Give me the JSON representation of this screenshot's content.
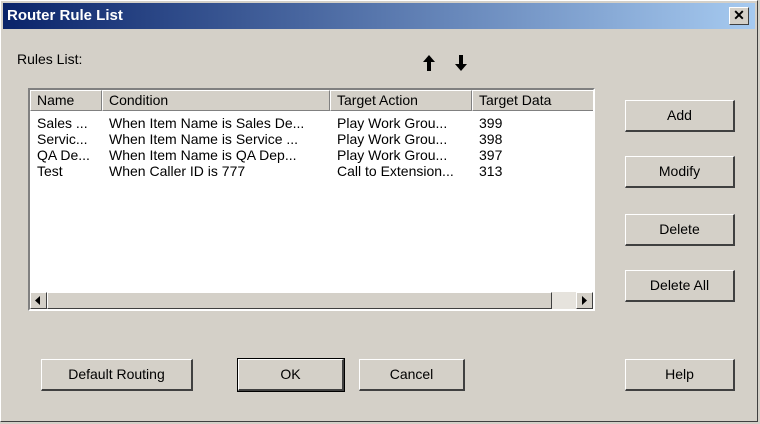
{
  "window": {
    "title": "Router Rule List",
    "close_label": "✕"
  },
  "rules_label": "Rules List:",
  "list": {
    "columns": [
      "Name",
      "Condition",
      "Target Action",
      "Target Data"
    ],
    "rows": [
      [
        "Sales ...",
        "When Item Name is Sales De...",
        "Play Work Grou...",
        "399"
      ],
      [
        "Servic...",
        "When Item Name is Service ...",
        "Play Work Grou...",
        "398"
      ],
      [
        "QA De...",
        "When Item Name is QA Dep...",
        "Play Work Grou...",
        "397"
      ],
      [
        "Test",
        "When Caller ID is 777",
        "Call to Extension...",
        "313"
      ]
    ]
  },
  "side_buttons": {
    "add": "Add",
    "modify": "Modify",
    "delete": "Delete",
    "delete_all": "Delete All"
  },
  "bottom_buttons": {
    "default_routing": "Default Routing",
    "ok": "OK",
    "cancel": "Cancel",
    "help": "Help"
  },
  "icons": {
    "move_up": "arrow-up-icon",
    "move_down": "arrow-down-icon",
    "scroll_left": "triangle-left-icon",
    "scroll_right": "triangle-right-icon"
  }
}
